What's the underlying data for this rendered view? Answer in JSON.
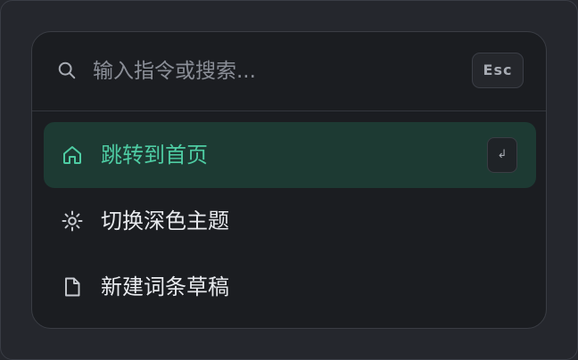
{
  "search": {
    "placeholder": "输入指令或搜索...",
    "value": "",
    "esc_label": "Esc",
    "icon": "search-icon"
  },
  "commands": [
    {
      "label": "跳转到首页",
      "icon": "home-icon",
      "active": true,
      "shortcut": "↲"
    },
    {
      "label": "切换深色主题",
      "icon": "sun-icon",
      "active": false
    },
    {
      "label": "新建词条草稿",
      "icon": "file-icon",
      "active": false
    }
  ],
  "colors": {
    "accent": "#4ecca3",
    "active_bg": "#1d3a33",
    "panel_bg": "#1b1d21"
  }
}
